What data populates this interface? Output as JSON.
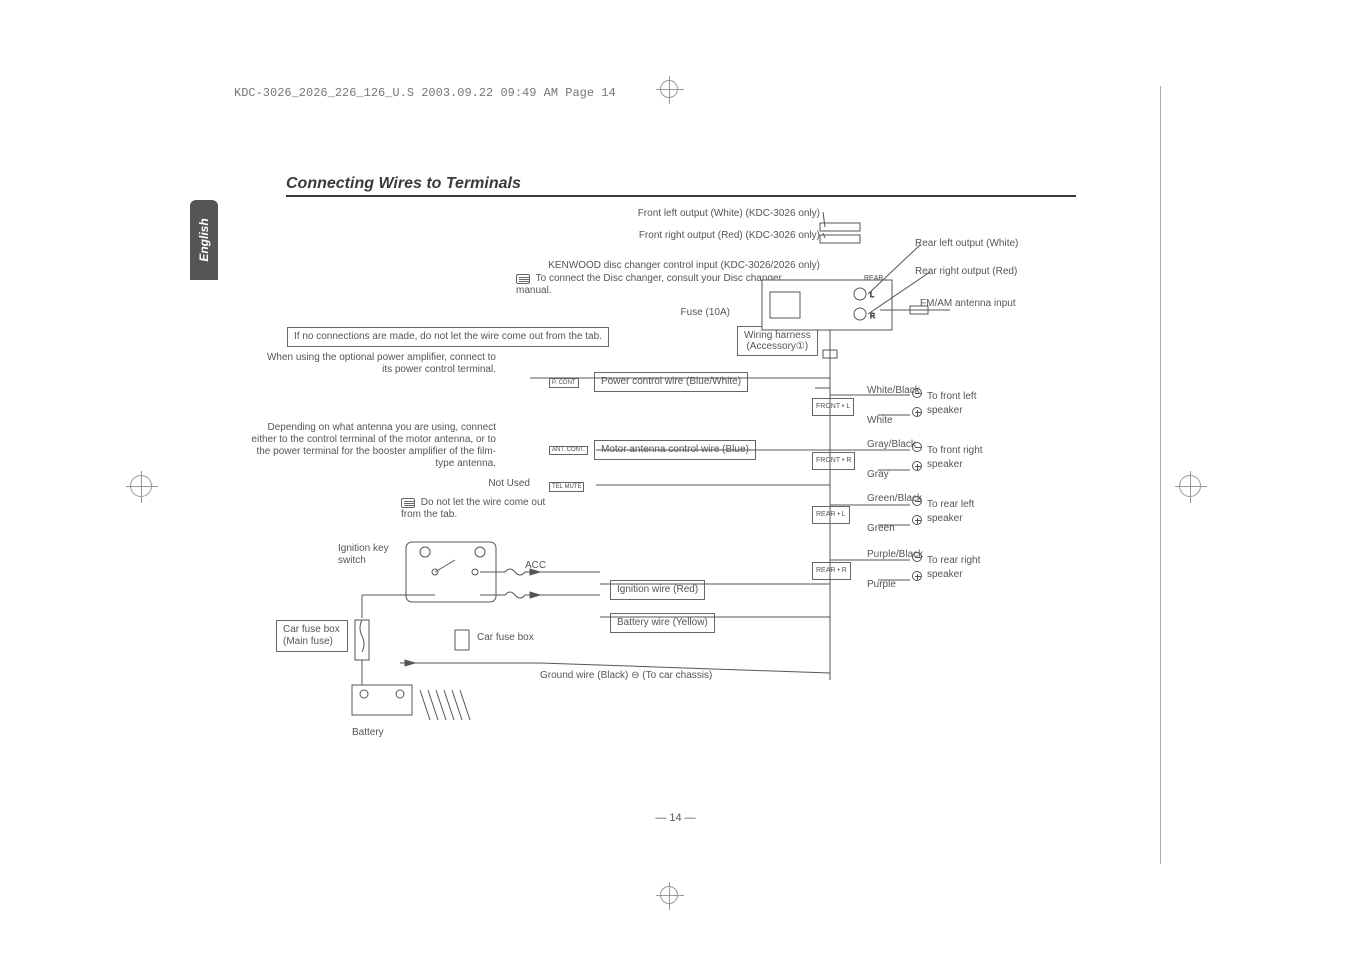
{
  "header": {
    "file_info": "KDC-3026_2026_226_126_U.S  2003.09.22  09:49 AM  Page 14"
  },
  "title": "Connecting Wires to Terminals",
  "language_tab": "English",
  "labels": {
    "front_left_out": "Front left output (White) (KDC-3026 only)",
    "front_right_out": "Front right output (Red) (KDC-3026 only)",
    "disc_changer": "KENWOOD disc changer control input (KDC-3026/2026 only)",
    "disc_changer_note": "To connect the Disc changer, consult your Disc changer manual.",
    "fuse": "Fuse (10A)",
    "no_connections": "If no connections are made, do not let the wire come out from the tab.",
    "wiring_harness": "Wiring harness",
    "accessory": "(Accessory①)",
    "rear_left_out": "Rear left output (White)",
    "rear_right_out": "Rear right output (Red)",
    "fm_am": "FM/AM antenna input",
    "power_amp_note": "When using the optional power amplifier, connect to its power control terminal.",
    "p_cont": "P. CONT",
    "power_control": "Power control wire (Blue/White)",
    "antenna_note": "Depending on what antenna you are using, connect either to the control terminal of the motor antenna, or to the power terminal for the booster amplifier of the film-type antenna.",
    "ant_cont": "ANT. CONT.",
    "motor_antenna": "Motor antenna control wire (Blue)",
    "not_used": "Not Used",
    "tel_mute": "TEL MUTE",
    "do_not_let_wire": "Do not let the wire come out from the tab.",
    "ignition_key": "Ignition key switch",
    "acc": "ACC",
    "ignition_wire": "Ignition wire (Red)",
    "battery_wire": "Battery wire (Yellow)",
    "car_fuse_box_main": "Car fuse box (Main fuse)",
    "car_fuse_box": "Car fuse box",
    "ground_wire": "Ground wire (Black) ⊖ (To car chassis)",
    "battery": "Battery",
    "rear_tag": "REAR"
  },
  "speakers": {
    "front_l": {
      "tag": "FRONT • L",
      "top": "White/Black",
      "bot": "White",
      "desc": "To front left speaker"
    },
    "front_r": {
      "tag": "FRONT • R",
      "top": "Gray/Black",
      "bot": "Gray",
      "desc": "To front right speaker"
    },
    "rear_l": {
      "tag": "REAR • L",
      "top": "Green/Black",
      "bot": "Green",
      "desc": "To rear left speaker"
    },
    "rear_r": {
      "tag": "REAR • R",
      "top": "Purple/Black",
      "bot": "Purple",
      "desc": "To rear right speaker"
    }
  },
  "page_number": "— 14 —"
}
